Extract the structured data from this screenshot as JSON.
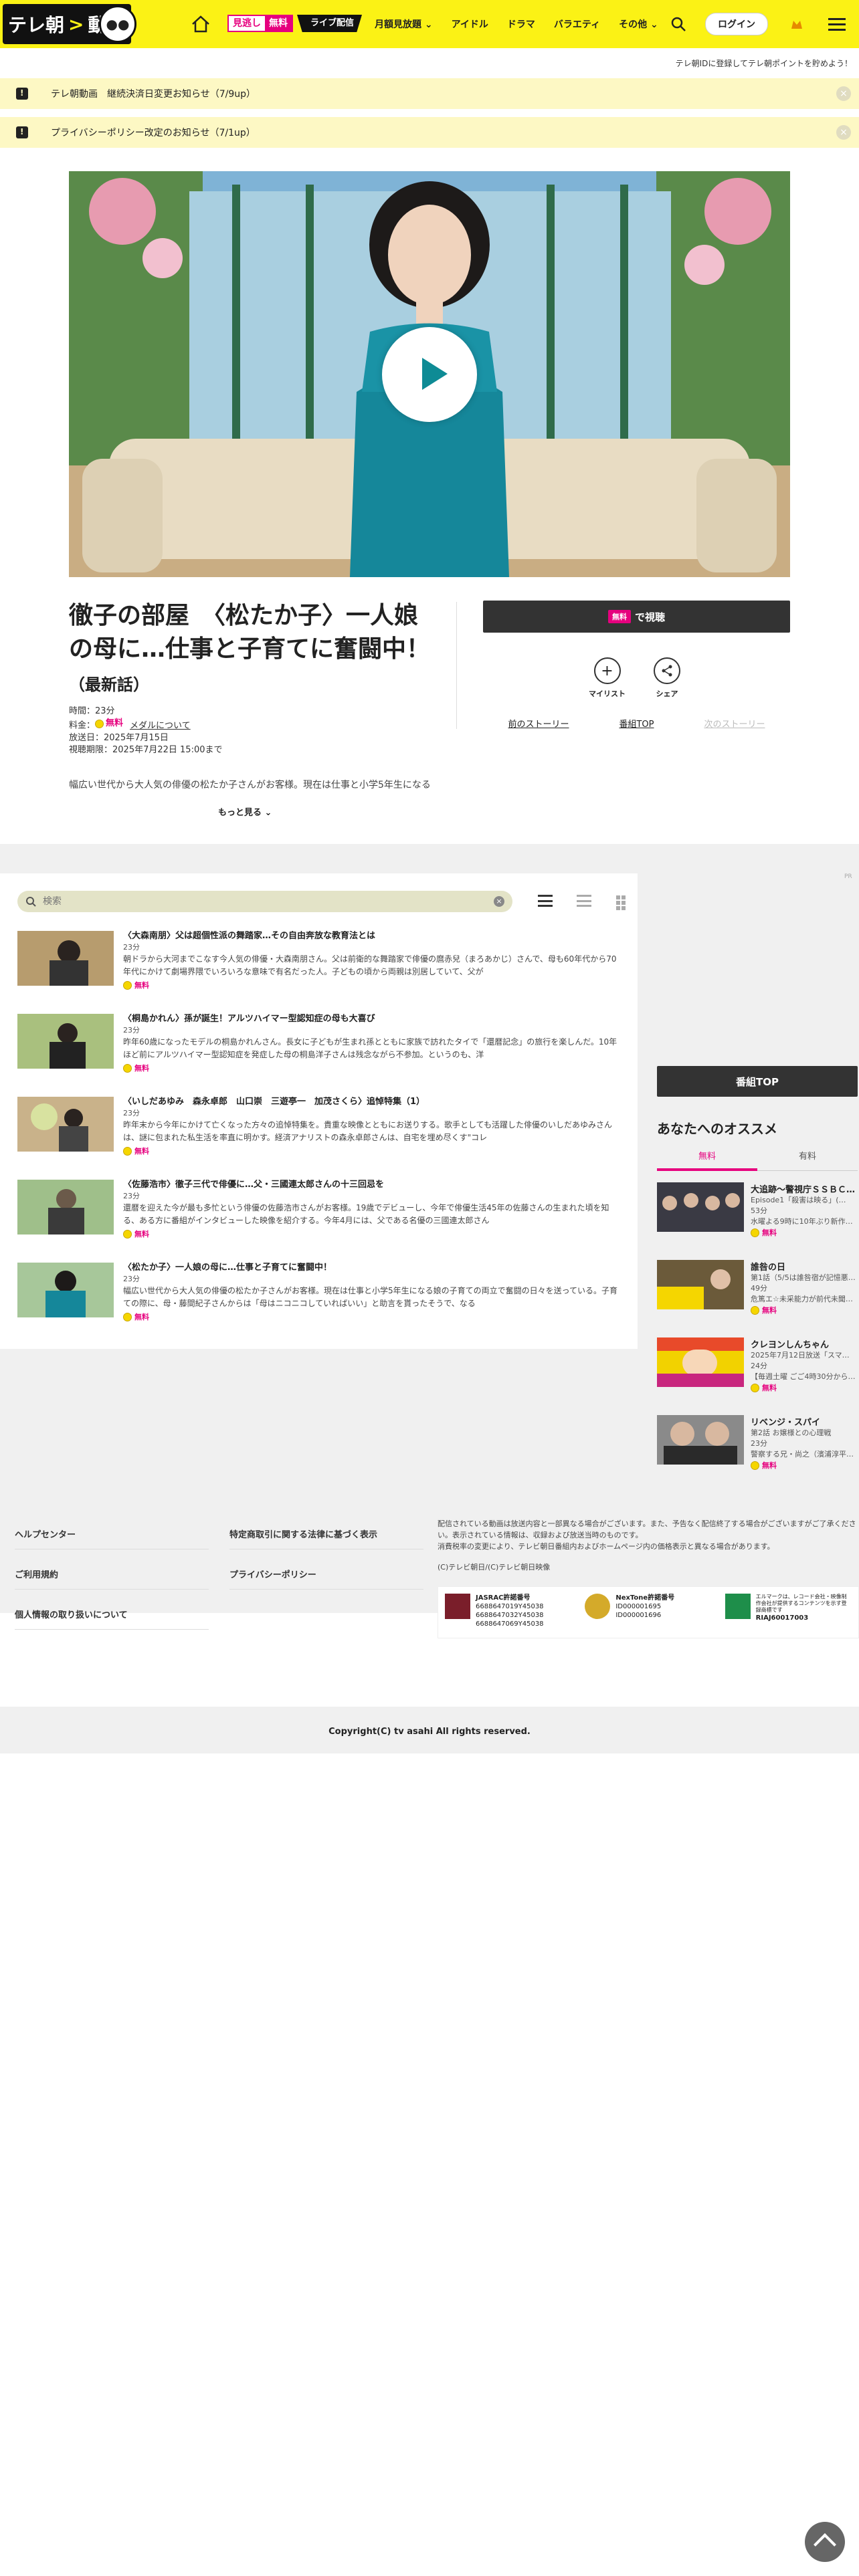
{
  "header": {
    "logo_text": "テレ朝",
    "logo_text2": "動画",
    "minogashi_label": "見逃し",
    "minogashi_free": "無料",
    "live_label": "ライブ配信",
    "nav": [
      "月額見放題",
      "アイドル",
      "ドラマ",
      "バラエティ",
      "その他"
    ],
    "login_label": "ログイン"
  },
  "promo_text": "テレ朝IDに登録してテレ朝ポイントを貯めよう！",
  "notices": [
    {
      "text": "テレ朝動画　継続決済日変更お知らせ（7/9up）"
    },
    {
      "text": "プライバシーポリシー改定のお知らせ（7/1up）"
    }
  ],
  "program": {
    "title": "徹子の部屋　〈松たか子〉一人娘の母に…仕事と子育てに奮闘中！",
    "title_suffix": "（最新話）",
    "duration": "時間：23分",
    "price_label": "料金：",
    "price_free": "無料",
    "member_link": "メダルについて",
    "air_date": "放送日：2025年7月15日",
    "deadline": "視聴期限：2025年7月22日 15:00まで",
    "description": "幅広い世代から大人気の俳優の松たか子さんがお客様。現在は仕事と小学5年生になる娘の",
    "more_label": "もっと見る"
  },
  "actions": {
    "watch_badge": "無料",
    "watch_label": "で視聴",
    "mylist": "マイリスト",
    "share": "シェア",
    "prev": "前のストーリー",
    "top": "番組TOP",
    "next": "次のストーリー"
  },
  "episode_search": {
    "placeholder": "検索"
  },
  "episodes": [
    {
      "title": "〈大森南朋〉父は超個性派の舞踏家…その自由奔放な教育法とは",
      "duration": "23分",
      "summary": "朝ドラから大河までこなす今人気の俳優・大森南朋さん。父は前衛的な舞踏家で俳優の麿赤兒（まろあかじ）さんで、母も60年代から70年代にかけて劇場界隈でいろいろな意味で有名だった人。子どもの頃から両親は別居していて、父が",
      "badge": "無料"
    },
    {
      "title": "〈桐島かれん〉孫が誕生！アルツハイマー型認知症の母も大喜び",
      "duration": "23分",
      "summary": "昨年60歳になったモデルの桐島かれんさん。長女に子どもが生まれ孫とともに家族で訪れたタイで「還暦記念」の旅行を楽しんだ。10年ほど前にアルツハイマー型認知症を発症した母の桐島洋子さんは残念ながら不参加。というのも、洋",
      "badge": "無料"
    },
    {
      "title": "〈いしだあゆみ　森永卓郎　山口崇　三遊亭一　加茂さくら〉追悼特集（1）",
      "duration": "23分",
      "summary": "昨年末から今年にかけて亡くなった方々の追悼特集を。貴重な映像とともにお送りする。歌手としても活躍した俳優のいしだあゆみさんは、謎に包まれた私生活を率直に明かす。経済アナリストの森永卓郎さんは、自宅を埋め尽くす\"コレ",
      "badge": "無料"
    },
    {
      "title": "〈佐藤浩市〉徹子三代で俳優に…父・三國連太郎さんの十三回忌を",
      "duration": "23分",
      "summary": "還暦を迎えた今が最も多忙という俳優の佐藤浩市さんがお客様。19歳でデビューし、今年で俳優生活45年の佐藤さんの生まれた頃を知る、ある方に番組がインタビューした映像を紹介する。今年4月には、父である名優の三國連太郎さん",
      "badge": "無料"
    },
    {
      "title": "〈松たか子〉一人娘の母に…仕事と子育てに奮闘中！",
      "duration": "23分",
      "summary": "幅広い世代から大人気の俳優の松たか子さんがお客様。現在は仕事と小学5年生になる娘の子育ての両立で奮闘の日々を送っている。子育ての際に、母・藤間紀子さんからは「母はニコニコしていればいい」と助言を貰ったそうで、なる",
      "badge": "無料"
    }
  ],
  "sidebar": {
    "bangumi_top": "番組TOP",
    "recommend_title": "あなたへのオススメ",
    "tab_free": "無料",
    "tab_paid": "有料",
    "items": [
      {
        "title": "大追跡～警視庁ＳＳＢＣ…",
        "sub1": "Episode1「殺害は映る」(…",
        "sub2": "53分",
        "sub3": "水曜よる9時に10年ぶり新作…",
        "badge": "無料"
      },
      {
        "title": "誰咎の日",
        "sub1": "第1話（5/5は誰咎宿が記憶悪…",
        "sub2": "49分",
        "sub3": "危篤エ☆未采能力が前代未聞…",
        "badge": "無料"
      },
      {
        "title": "クレヨンしんちゃん",
        "sub1": "2025年7月12日放送「スマ…",
        "sub2": "24分",
        "sub3": "【毎週土曜 ごご4時30分から…",
        "badge": "無料"
      },
      {
        "title": "リベンジ・スパイ",
        "sub1": "第2話 お嬢様との心理戦",
        "sub2": "23分",
        "sub3": "警察する兄・尚之（濱浦淳平…",
        "badge": "無料"
      }
    ]
  },
  "footer": {
    "links_left": [
      "ヘルプセンター",
      "ご利用規約",
      "個人情報の取り扱いについて"
    ],
    "links_right": [
      "特定商取引に関する法律に基づく表示",
      "プライバシーポリシー"
    ],
    "notice": "配信されている動画は放送内容と一部異なる場合がございます。また、予告なく配信終了する場合がございますがご了承ください。表示されている情報は、収録および放送当時のものです。",
    "notice2": "消費税率の変更により、テレビ朝日番組内およびホームページ内の価格表示と異なる場合があります。",
    "credit": "(C)テレビ朝日/(C)テレビ朝日映像",
    "jasrac_title": "JASRAC許諾番号",
    "jasrac_nums": [
      "6688647019Y45038",
      "6688647032Y45038",
      "6688647069Y45038"
    ],
    "nextone_title": "NexTone許諾番号",
    "nextone_nums": [
      "ID000001695",
      "ID000001696"
    ],
    "riaj_text": "エルマークは、レコード会社・映像制作会社が提供するコンテンツを示す登録商標です",
    "riaj_num": "RIAJ60017003",
    "copyright": "Copyright(C) tv asahi All rights reserved."
  },
  "ad_tag": "PR"
}
